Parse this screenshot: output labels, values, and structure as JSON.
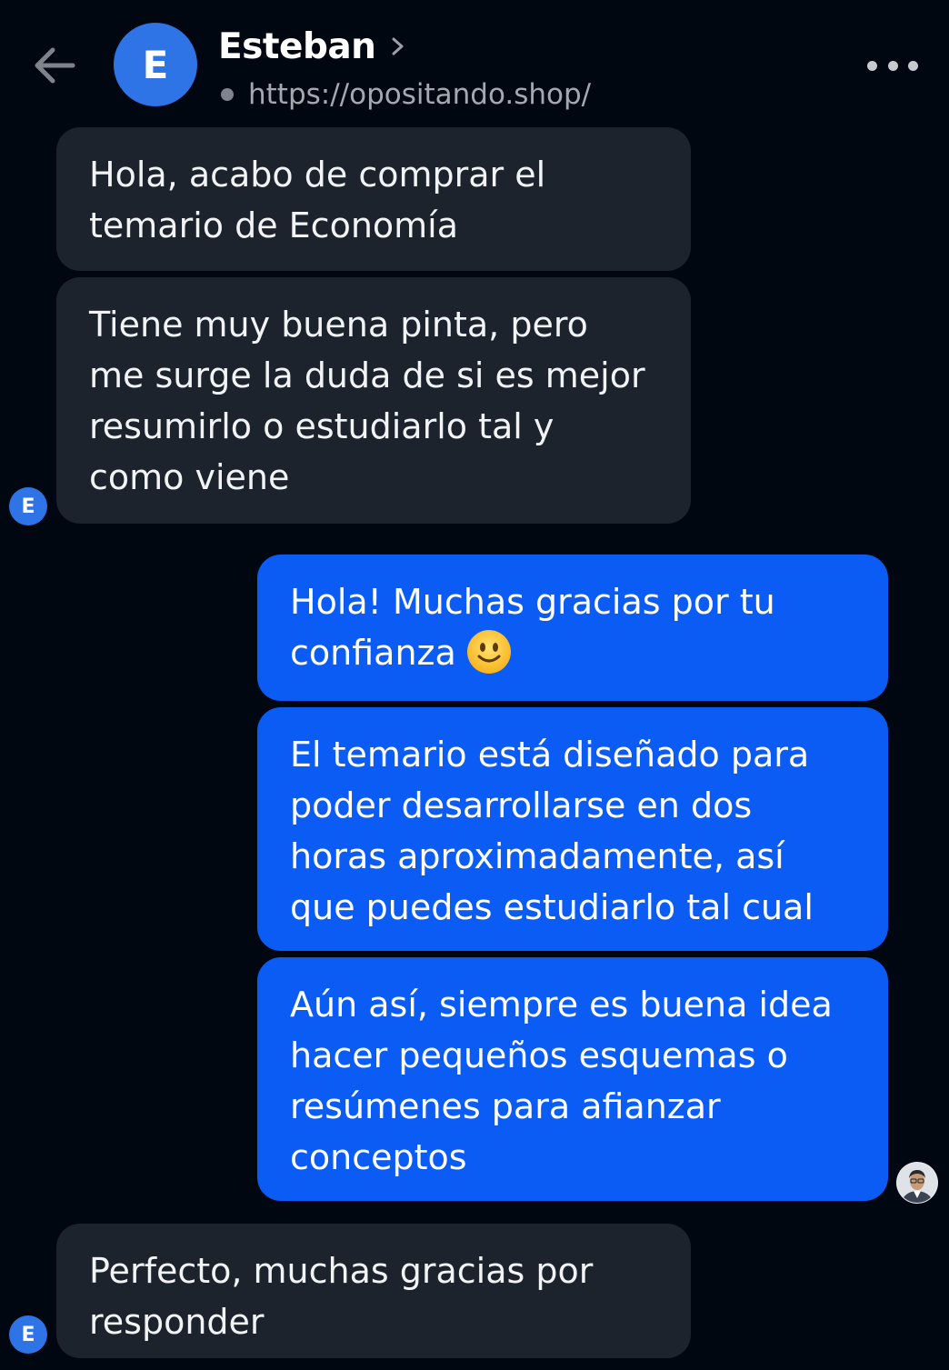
{
  "header": {
    "avatar_letter": "E",
    "contact_name": "Esteban",
    "url": "https://opositando.shop/"
  },
  "messages": [
    {
      "from": "contact",
      "text": "Hola, acabo de comprar el\ntemario de Economía"
    },
    {
      "from": "contact",
      "text": "Tiene muy buena pinta, pero\nme surge la duda de si es mejor\nresumirlo o estudiarlo tal y\ncomo viene"
    },
    {
      "from": "me",
      "text": "Hola! Muchas gracias por tu\nconfianza",
      "emoji": "slightly-smiling-face"
    },
    {
      "from": "me",
      "text": "El temario está diseñado para\npoder desarrollarse en dos\nhoras aproximadamente, así\nque puedes estudiarlo tal cual"
    },
    {
      "from": "me",
      "text": "Aún así, siempre es buena idea\nhacer pequeños esquemas o\nresúmenes para afianzar\nconceptos"
    },
    {
      "from": "contact",
      "text": "Perfecto, muchas gracias por\nresponder"
    }
  ],
  "mini_avatar_letter": "E",
  "colors": {
    "background": "#010711",
    "incoming_bubble": "#1c232d",
    "outgoing_bubble": "#0a5cf5",
    "avatar": "#2f74e6"
  },
  "icons": [
    "arrow-left-icon",
    "chevron-right-icon",
    "more-horizontal-icon",
    "slightly-smiling-face-emoji",
    "agent-avatar-photo"
  ]
}
